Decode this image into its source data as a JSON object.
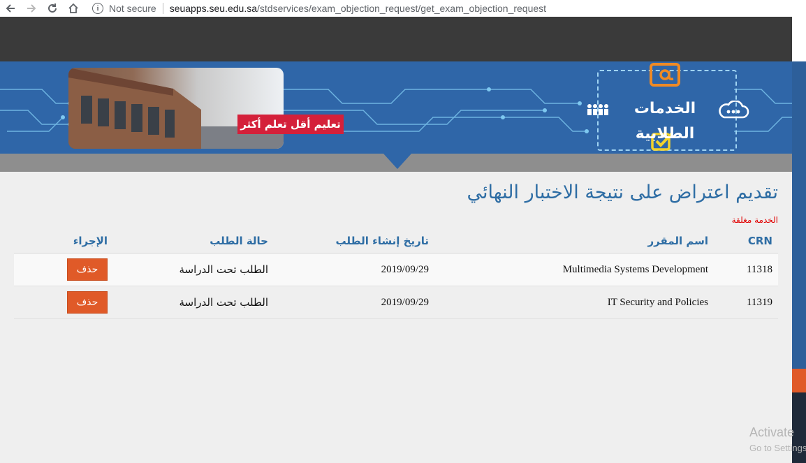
{
  "browser": {
    "security_label": "Not secure",
    "url_host": "seuapps.seu.edu.sa",
    "url_path": "/stdservices/exam_objection_request/get_exam_objection_request"
  },
  "banner": {
    "slogan": "تعليم أقل تعلم أكثر",
    "services_title": "الخدمات الطلابية"
  },
  "page": {
    "title": "تقديم اعتراض على نتيجة الاختبار النهائي",
    "status_note": "الخدمة مغلقة"
  },
  "table": {
    "headers": {
      "crn": "CRN",
      "course": "اسم المقرر",
      "created": "تاريخ إنشاء الطلب",
      "status": "حالة الطلب",
      "action": "الإجراء"
    },
    "rows": [
      {
        "crn": "11318",
        "course": "Multimedia Systems Development",
        "created": "2019/09/29",
        "status": "الطلب تحت الدراسة",
        "action": "حذف"
      },
      {
        "crn": "11319",
        "course": "IT Security and Policies",
        "created": "2019/09/29",
        "status": "الطلب تحت الدراسة",
        "action": "حذف"
      }
    ]
  },
  "watermark": {
    "line1": "Activate",
    "line2": "Go to Settings"
  },
  "colors": {
    "banner_blue": "#2f66a8",
    "title_blue": "#2e6da4",
    "delete_orange": "#e05a28",
    "closed_red": "#e00000"
  }
}
